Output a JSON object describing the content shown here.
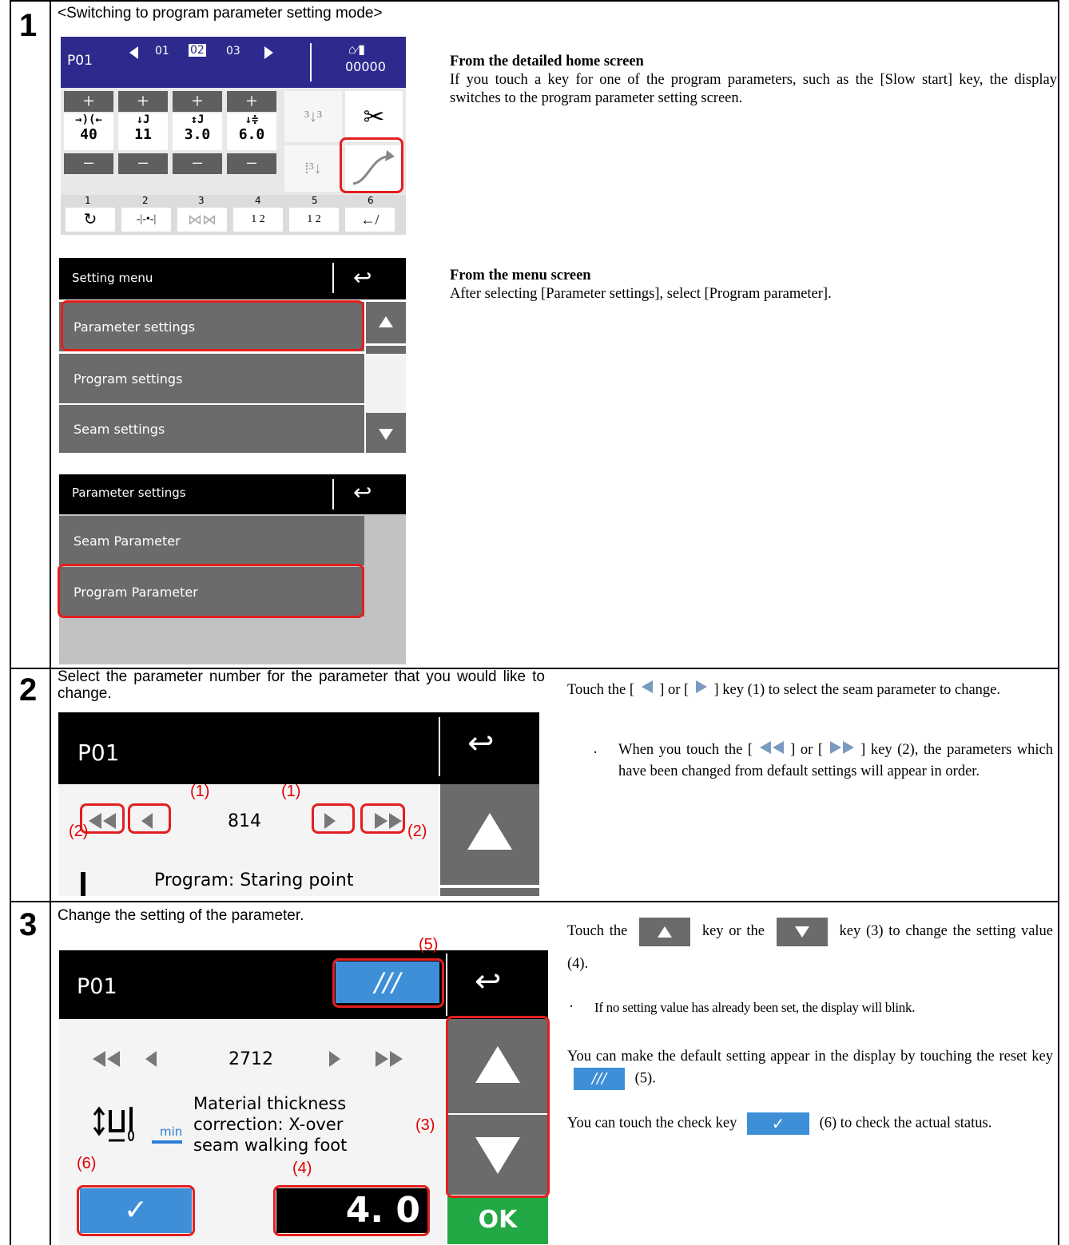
{
  "steps": [
    {
      "num": "1",
      "title": "<Switching to program parameter setting mode>",
      "home_screen": {
        "program": "P01",
        "tabs": [
          "01",
          "02",
          "03"
        ],
        "counter": "00000",
        "values": [
          "40",
          "11",
          "3.0",
          "6.0"
        ],
        "slot_numbers": [
          "1",
          "2",
          "3",
          "4",
          "5",
          "6"
        ]
      },
      "detailed_heading": "From the detailed home screen",
      "detailed_text": "If you touch a key for one of the program parameters, such as the [Slow start] key, the display switches to the program parameter setting screen.",
      "setting_menu": {
        "title": "Setting menu",
        "items": [
          "Parameter settings",
          "Program settings",
          "Seam settings"
        ]
      },
      "menu_heading": "From the menu screen",
      "menu_text": "After selecting [Parameter settings], select [Program parameter].",
      "parameter_menu": {
        "title": "Parameter settings",
        "items": [
          "Seam Parameter",
          "Program Parameter"
        ]
      }
    },
    {
      "num": "2",
      "text": "Select the parameter number for the parameter that you would like to change.",
      "screen": {
        "program": "P01",
        "number": "814",
        "name": "Program: Staring point",
        "callout_1": "(1)",
        "callout_2": "(2)"
      },
      "desc_1a": "Touch the [",
      "desc_1b": "] or [",
      "desc_1c": "] key (1) to select the seam parameter to change.",
      "bullet_a": "When you touch the [",
      "bullet_b": "] or [",
      "bullet_c": "] key (2), the parameters which have been changed from default settings will appear in order.",
      "bullet_mark": "·"
    },
    {
      "num": "3",
      "text": "Change the setting of the parameter.",
      "screen": {
        "program": "P01",
        "number": "2712",
        "name_line1": "Material thickness",
        "name_line2": "correction: X-over",
        "name_line3": "seam walking foot",
        "unit": "min",
        "value": "4. 0",
        "ok": "OK",
        "callout_3": "(3)",
        "callout_4": "(4)",
        "callout_5": "(5)",
        "callout_6": "(6)"
      },
      "desc_1a": "Touch the",
      "desc_1b": "key or the",
      "desc_1c": "key (3) to change the setting value (4).",
      "bullet": "If no setting value has already been set, the display will blink.",
      "bullet_mark": "·",
      "reset_a": "You can make the default setting appear in the display by touching the reset key",
      "reset_b": "(5).",
      "check_a": "You can touch the check key",
      "check_b": "(6) to check the actual status."
    }
  ],
  "colors": {
    "callout": "#e00000",
    "highlight": "#e41e1e",
    "home_header": "#2c2a8c",
    "blue_key": "#3f8fd8",
    "ok_green": "#22a844"
  }
}
